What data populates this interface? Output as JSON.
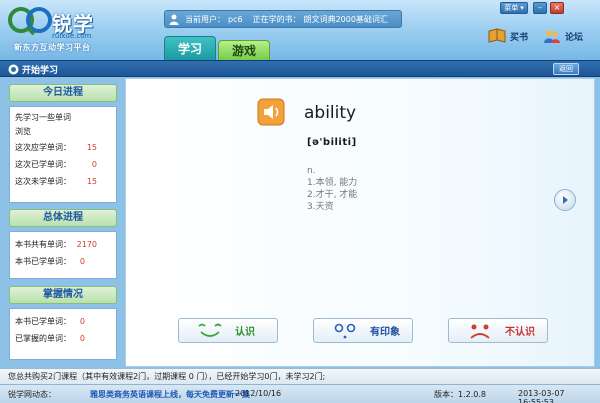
{
  "header": {
    "logo_text": "锐学",
    "logo_domain": "ruixue.com",
    "logo_tagline": "新东方互动学习平台",
    "current_user_label": "当前用户：",
    "current_user": "pc6",
    "current_book_label": "正在学的书：",
    "current_book": "朗文词典2000基础词汇",
    "menu_label": "菜单",
    "buy_book": "买书",
    "forum": "论坛",
    "tabs": [
      {
        "label": "学习"
      },
      {
        "label": "游戏"
      }
    ]
  },
  "titlebar": {
    "title": "开始学习",
    "back": "返回"
  },
  "sidebar": {
    "today": {
      "title": "今日进程",
      "intro": [
        "先学习一些单词",
        "浏览"
      ],
      "rows": [
        {
          "label": "这次应学单词：",
          "value": "15"
        },
        {
          "label": "这次已学单词：",
          "value": "0"
        },
        {
          "label": "这次未学单词：",
          "value": "15"
        }
      ]
    },
    "overall": {
      "title": "总体进程",
      "rows": [
        {
          "label": "本书共有单词：",
          "value": "2170"
        },
        {
          "label": "本书已学单词：",
          "value": "0"
        }
      ]
    },
    "mastery": {
      "title": "掌握情况",
      "rows": [
        {
          "label": "本书已学单词：",
          "value": "0"
        },
        {
          "label": "已掌握的单词：",
          "value": "0"
        }
      ]
    }
  },
  "main": {
    "word": "ability",
    "phonetic": "[ə'biliti]",
    "pos": "n.",
    "definitions": [
      "1.本领, 能力",
      "2.才干, 才能",
      "3.天资"
    ],
    "answers": {
      "know": "认识",
      "vague": "有印象",
      "unknown": "不认识"
    }
  },
  "status": {
    "message": "您总共购买2门课程（其中有效课程2门，过期课程 0 门），已经开始学习0门，未学习2门;",
    "news_label": "锐学网动态：",
    "news_link": "雅思类商务英语课程上线，每天免费更新一集",
    "news_date": "2012/10/16",
    "version": "版本：1.2.0.8",
    "datetime": "2013-03-07 16:55:53"
  },
  "colors": {
    "accent": "#2f6fb0",
    "value_red": "#d23b2b",
    "know_green": "#2e8d2e",
    "unknown_red": "#c8322c"
  }
}
